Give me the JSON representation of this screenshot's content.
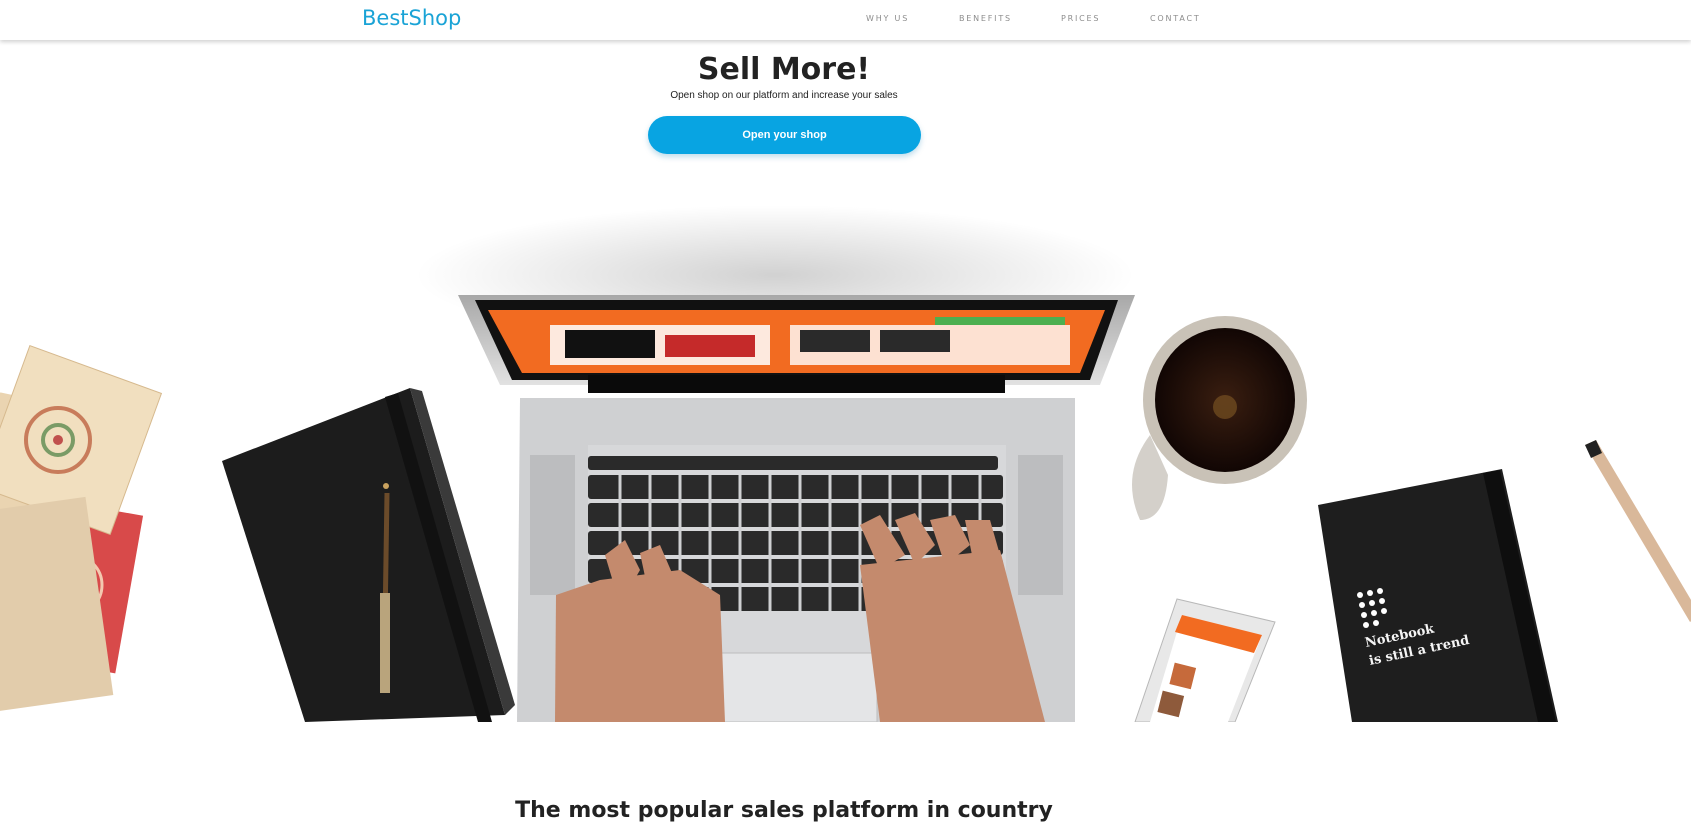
{
  "navbar": {
    "logo": "BestShop",
    "links": [
      {
        "label": "WHY US"
      },
      {
        "label": "BENEFITS"
      },
      {
        "label": "PRICES"
      },
      {
        "label": "CONTACT"
      }
    ]
  },
  "hero": {
    "title": "Sell More!",
    "subtitle": "Open shop on our platform and increase your sales",
    "cta_label": "Open your shop"
  },
  "illustration": {
    "notebook_text_line1": "Notebook",
    "notebook_text_line2": "is still a trend"
  },
  "section": {
    "title": "The most popular sales platform in country"
  },
  "colors": {
    "brand": "#1aa3d6",
    "button": "#08a4e2",
    "screen_accent": "#f26b21"
  }
}
